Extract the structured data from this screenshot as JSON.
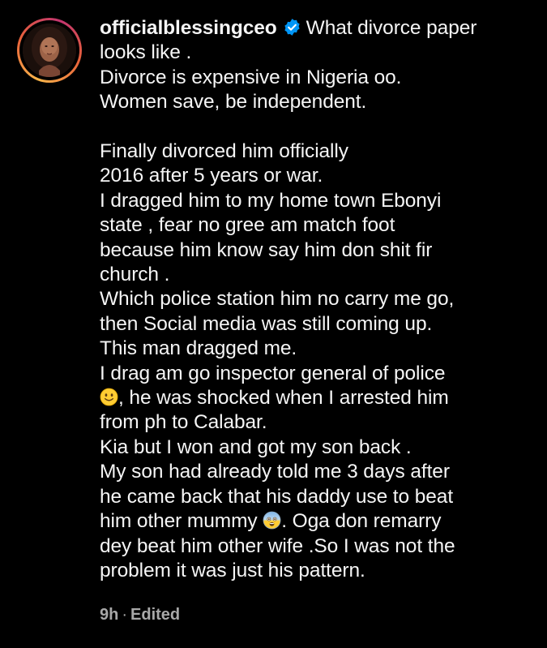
{
  "post": {
    "username": "officialblessingceo",
    "verified_icon": "verified-badge-icon",
    "caption_first": "What divorce paper",
    "caption_lines": [
      "looks like .",
      "Divorce is expensive in Nigeria oo.",
      "Women save, be independent.",
      "",
      "Finally divorced him officially",
      "2016 after 5 years or war.",
      "I dragged him to my home town Ebonyi",
      "state , fear no gree am match foot",
      "because him know say him don shit fir",
      "church .",
      "Which police station him no carry me go,",
      "then Social media was still coming up.",
      "This man dragged me.",
      "I drag am go inspector general of police"
    ],
    "emoji_line_1_after": ", he was shocked when I arrested him",
    "emoji_1": "slightly-smiling-face-emoji",
    "caption_lines_2": [
      "from ph to Calabar.",
      "Kia but I won and got my son back .",
      "My son had already told me 3 days after",
      "he came back that his daddy use to beat"
    ],
    "emoji_line_2_before": "him other mummy",
    "emoji_2": "fearful-face-emoji",
    "emoji_line_2_after": ". Oga don remarry",
    "caption_lines_3": [
      "dey beat him other wife .So I was not the",
      "problem it was just his pattern."
    ],
    "time": "9h",
    "separator": "·",
    "edited": "Edited"
  },
  "colors": {
    "background": "#000000",
    "text": "#f5f5f5",
    "meta": "#a8a8a8",
    "verified": "#0095f6"
  }
}
